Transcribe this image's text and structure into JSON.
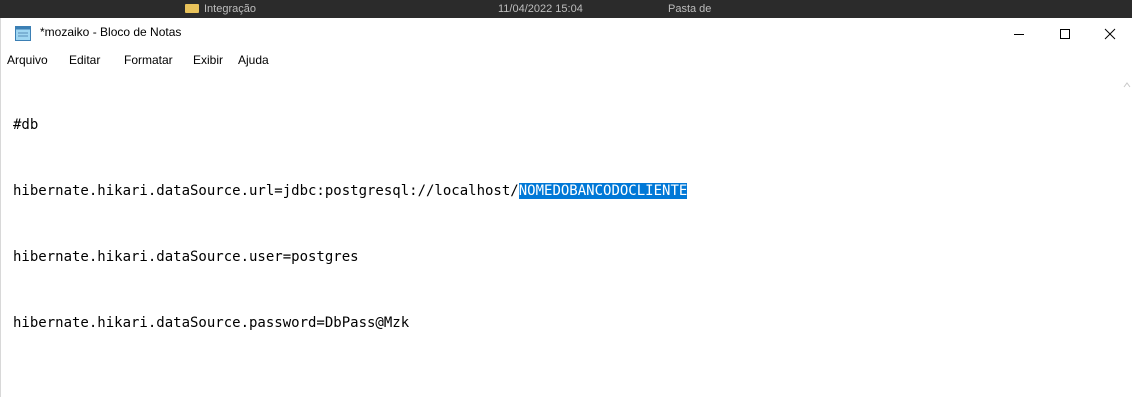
{
  "background_window": {
    "item_name": "Integração",
    "date": "11/04/2022 15:04",
    "type": "Pasta de"
  },
  "window": {
    "title": "*mozaiko - Bloco de Notas",
    "icon": "notepad-icon",
    "controls": [
      "minimize-icon",
      "maximize-icon",
      "close-icon"
    ]
  },
  "menu": [
    "Arquivo",
    "Editar",
    "Formatar",
    "Exibir",
    "Ajuda"
  ],
  "editor": {
    "lines": [
      "#db",
      "hibernate.hikari.dataSource.url=jdbc:postgresql://localhost/",
      "hibernate.hikari.dataSource.user=postgres",
      "hibernate.hikari.dataSource.password=DbPass@Mzk"
    ],
    "selected_text": "NOMEDOBANCODOCLIENTE"
  },
  "colors": {
    "selection": "#0078d7",
    "selection_text": "#ffffff",
    "background_window": "#2b2b2b"
  }
}
